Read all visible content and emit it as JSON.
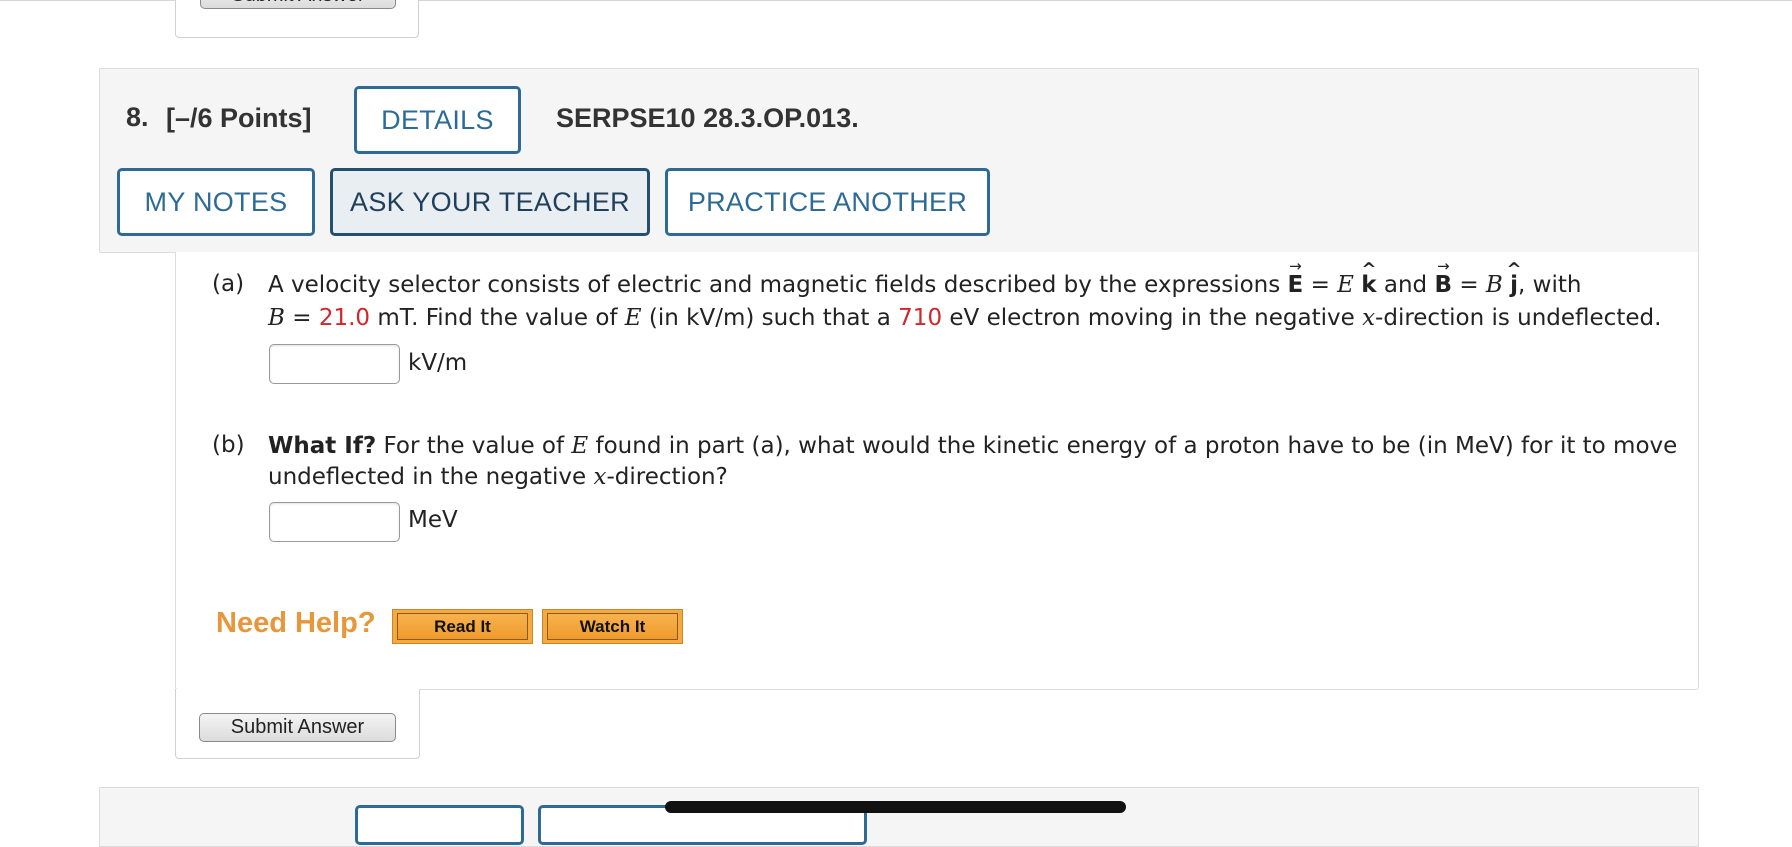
{
  "previous": {
    "submit_label": "Submit Answer"
  },
  "question": {
    "number": "8.",
    "points": "[–/6 Points]",
    "details_label": "DETAILS",
    "code": "SERPSE10 28.3.OP.013.",
    "buttons": {
      "my_notes": "MY NOTES",
      "ask_teacher": "ASK YOUR TEACHER",
      "practice_another": "PRACTICE ANOTHER"
    }
  },
  "part_a": {
    "label": "(a)",
    "line1": {
      "t1": "A velocity selector consists of electric and magnetic fields described by the expressions ",
      "E": "E",
      "eq1": " = ",
      "E_italic": "E",
      "k": "k",
      "and": " and ",
      "B": "B",
      "eq2": " = ",
      "B_italic": "B",
      "j": "j",
      "tail": ", with"
    },
    "line2": {
      "B_italic": "B",
      "eq": " = ",
      "B_value": "21.0",
      "t1": " mT. Find the value of ",
      "E_italic": "E",
      "t2": " (in kV/m) such that a ",
      "energy_value": "710",
      "t3": " eV electron moving in the negative ",
      "x_italic": "x",
      "t4": "-direction is undeflected."
    },
    "answer_value": "",
    "unit": "kV/m"
  },
  "part_b": {
    "label": "(b)",
    "line1": {
      "bold": "What If?",
      "t1": " For the value of ",
      "E_italic": "E",
      "t2": " found in part (a), what would the kinetic energy of a proton have to be (in MeV) for it to move"
    },
    "line2": {
      "t1": "undeflected in the negative ",
      "x_italic": "x",
      "t2": "-direction?"
    },
    "answer_value": "",
    "unit": "MeV"
  },
  "help": {
    "label": "Need Help?",
    "read_it": "Read It",
    "watch_it": "Watch It"
  },
  "submit_label": "Submit Answer",
  "colors": {
    "accent_blue": "#2d6b96",
    "value_red": "#d2262a",
    "help_orange": "#e8963a"
  }
}
